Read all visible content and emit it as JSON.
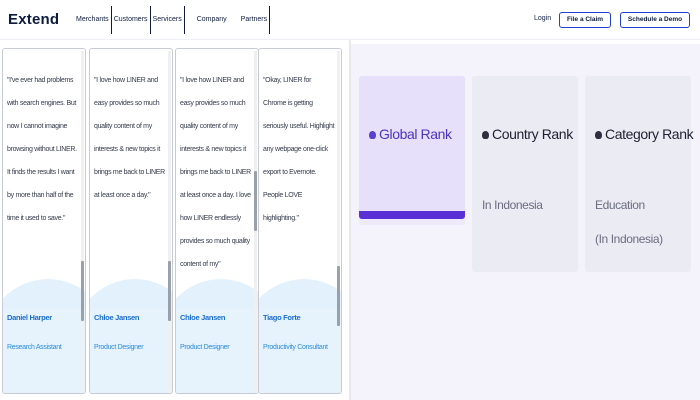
{
  "header": {
    "logo": "Extend",
    "nav": [
      "Merchants",
      "Customers",
      "Servicers",
      "Company",
      "Partners"
    ],
    "login": "Login",
    "file_claim": "File a Claim",
    "schedule_demo": "Schedule a Demo"
  },
  "testimonials": [
    {
      "quote": "\"I've ever had problems with search engines. But now I cannot imagine browsing without LINER. It finds the results I want by more than half of the time it used to save.\"",
      "name": "Daniel Harper",
      "role": "Research Assistant"
    },
    {
      "quote": "\"I love how LINER and easy provides so much quality content of my interests & new topics it brings me back to LINER at least once a day.\"",
      "name": "Chloe Jansen",
      "role": "Product Designer"
    },
    {
      "quote": "\"I love how LINER and easy provides so much quality content of my interests & new topics it brings me back to LINER at least once a day. I love how LINER endlessly provides so much quality content of my\"",
      "name": "Chloe Jansen",
      "role": "Product Designer"
    },
    {
      "quote": "\"Okay, LINER for Chrome is getting seriously useful. Highlight any webpage one-click export to Evernote. People LOVE highlighting.\"",
      "name": "Tiago Forte",
      "role": "Productivity Consultant"
    }
  ],
  "ranks": {
    "global": {
      "title": "Global Rank"
    },
    "country": {
      "title": "Country Rank",
      "sub": "In Indonesia"
    },
    "category": {
      "title": "Category Rank",
      "sub1": "Education",
      "sub2": "(In Indonesia)"
    }
  },
  "colors": {
    "accent": "#1f3fd6",
    "rank_bar": "#5b2fd6",
    "name": "#1a6dd1"
  }
}
